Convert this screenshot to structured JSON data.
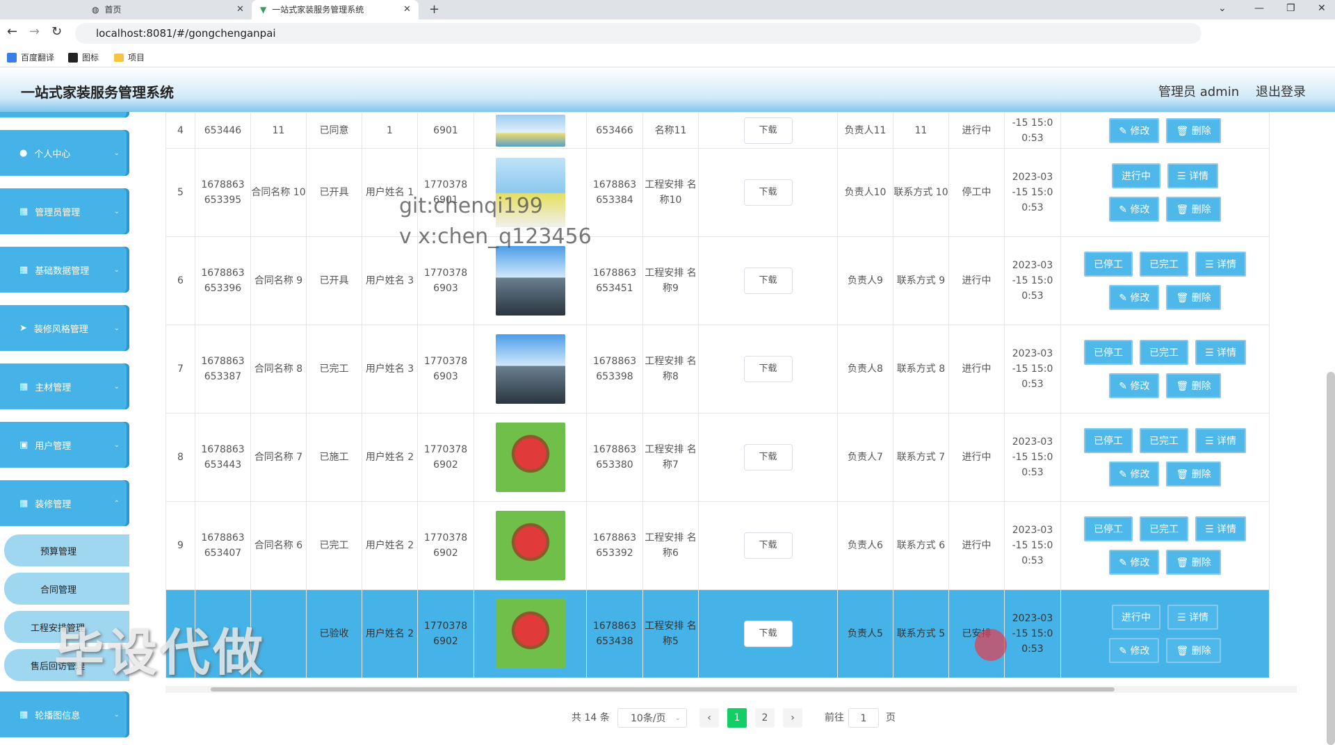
{
  "browser": {
    "tabs": [
      {
        "label": "首页"
      },
      {
        "label": "一站式家装服务管理系统"
      }
    ],
    "url": "localhost:8081/#/gongchenganpai",
    "bookmarks": [
      "百度翻译",
      "图标",
      "项目"
    ]
  },
  "header": {
    "title": "一站式家装服务管理系统",
    "admin": "管理员 admin",
    "logout": "退出登录"
  },
  "sidebar": {
    "items": [
      "个人中心",
      "管理员管理",
      "基础数据管理",
      "装修风格管理",
      "主材管理",
      "用户管理",
      "装修管理"
    ],
    "subitems": [
      "预算管理",
      "合同管理",
      "工程安排管理",
      "售后回访管理"
    ],
    "last": "轮播图信息"
  },
  "rows": [
    {
      "idx": "4",
      "contract_no": "653446",
      "contract_name": "11",
      "status": "已同意",
      "user": "1",
      "phone": "6901",
      "proj_no": "653466",
      "proj_name": "名称11",
      "download": "下载",
      "owner": "负责人11",
      "contact": "11",
      "state": "进行中",
      "time": "-15 15:0 0:53",
      "actions": [
        "修改",
        "删除"
      ]
    },
    {
      "idx": "5",
      "contract_no": "1678863 653395",
      "contract_name": "合同名称 10",
      "status": "已开具",
      "user": "用户姓名 1",
      "phone": "1770378 6901",
      "proj_no": "1678863 653384",
      "proj_name": "工程安排 名称10",
      "download": "下载",
      "owner": "负责人10",
      "contact": "联系方式 10",
      "state": "停工中",
      "time": "2023-03 -15 15:0 0:53",
      "actions": [
        "进行中",
        "详情",
        "修改",
        "删除"
      ]
    },
    {
      "idx": "6",
      "contract_no": "1678863 653396",
      "contract_name": "合同名称 9",
      "status": "已开具",
      "user": "用户姓名 3",
      "phone": "1770378 6903",
      "proj_no": "1678863 653451",
      "proj_name": "工程安排 名称9",
      "download": "下载",
      "owner": "负责人9",
      "contact": "联系方式 9",
      "state": "进行中",
      "time": "2023-03 -15 15:0 0:53",
      "actions": [
        "已停工",
        "已完工",
        "详情",
        "修改",
        "删除"
      ]
    },
    {
      "idx": "7",
      "contract_no": "1678863 653387",
      "contract_name": "合同名称 8",
      "status": "已完工",
      "user": "用户姓名 3",
      "phone": "1770378 6903",
      "proj_no": "1678863 653398",
      "proj_name": "工程安排 名称8",
      "download": "下载",
      "owner": "负责人8",
      "contact": "联系方式 8",
      "state": "进行中",
      "time": "2023-03 -15 15:0 0:53",
      "actions": [
        "已停工",
        "已完工",
        "详情",
        "修改",
        "删除"
      ]
    },
    {
      "idx": "8",
      "contract_no": "1678863 653443",
      "contract_name": "合同名称 7",
      "status": "已施工",
      "user": "用户姓名 2",
      "phone": "1770378 6902",
      "proj_no": "1678863 653380",
      "proj_name": "工程安排 名称7",
      "download": "下载",
      "owner": "负责人7",
      "contact": "联系方式 7",
      "state": "进行中",
      "time": "2023-03 -15 15:0 0:53",
      "actions": [
        "已停工",
        "已完工",
        "详情",
        "修改",
        "删除"
      ]
    },
    {
      "idx": "9",
      "contract_no": "1678863 653407",
      "contract_name": "合同名称 6",
      "status": "已完工",
      "user": "用户姓名 2",
      "phone": "1770378 6902",
      "proj_no": "1678863 653392",
      "proj_name": "工程安排 名称6",
      "download": "下载",
      "owner": "负责人6",
      "contact": "联系方式 6",
      "state": "进行中",
      "time": "2023-03 -15 15:0 0:53",
      "actions": [
        "已停工",
        "已完工",
        "详情",
        "修改",
        "删除"
      ]
    },
    {
      "idx": "",
      "contract_no": "",
      "contract_name": "",
      "status": "已验收",
      "user": "用户姓名 2",
      "phone": "1770378 6902",
      "proj_no": "1678863 653438",
      "proj_name": "工程安排 名称5",
      "download": "下载",
      "owner": "负责人5",
      "contact": "联系方式 5",
      "state": "已安排",
      "time": "2023-03 -15 15:0 0:53",
      "actions": [
        "进行中",
        "详情",
        "修改",
        "删除"
      ]
    }
  ],
  "pagination": {
    "total": "共 14 条",
    "size": "10条/页",
    "pages": [
      "1",
      "2"
    ],
    "goto": "前往",
    "page": "1",
    "unit": "页"
  },
  "watermark": {
    "line1": "git:chenqi199",
    "line2": "v x:chen_q123456",
    "big": "毕设代做"
  }
}
